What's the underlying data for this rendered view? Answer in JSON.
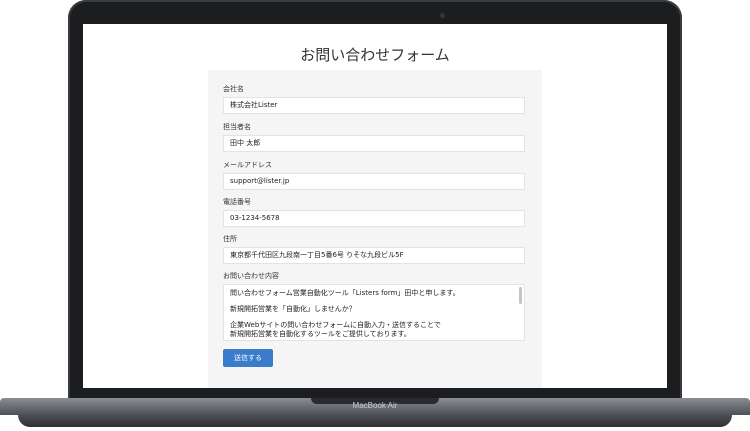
{
  "page": {
    "title": "お問い合わせフォーム"
  },
  "device": {
    "label": "MacBook Air"
  },
  "form": {
    "fields": [
      {
        "label": "会社名",
        "value": "株式会社Lister"
      },
      {
        "label": "担当者名",
        "value": "田中 太郎"
      },
      {
        "label": "メールアドレス",
        "value": "support@lister.jp"
      },
      {
        "label": "電話番号",
        "value": "03-1234-5678"
      },
      {
        "label": "住所",
        "value": "東京都千代田区九段南一丁目5番6号 りそな九段ビル5F"
      }
    ],
    "message": {
      "label": "お問い合わせ内容",
      "lines": [
        "問い合わせフォーム営業自動化ツール「Listers form」田中と申します。",
        "新規開拓営業を「自動化」しませんか？",
        "企業Webサイトの問い合わせフォームに自動入力・送信することで",
        "新規開拓営業を自動化するツールをご提供しております。"
      ]
    },
    "submit_label": "送信する"
  },
  "colors": {
    "accent": "#3a7ccb",
    "panel": "#f5f5f5",
    "bezel": "#1c1d1f"
  }
}
